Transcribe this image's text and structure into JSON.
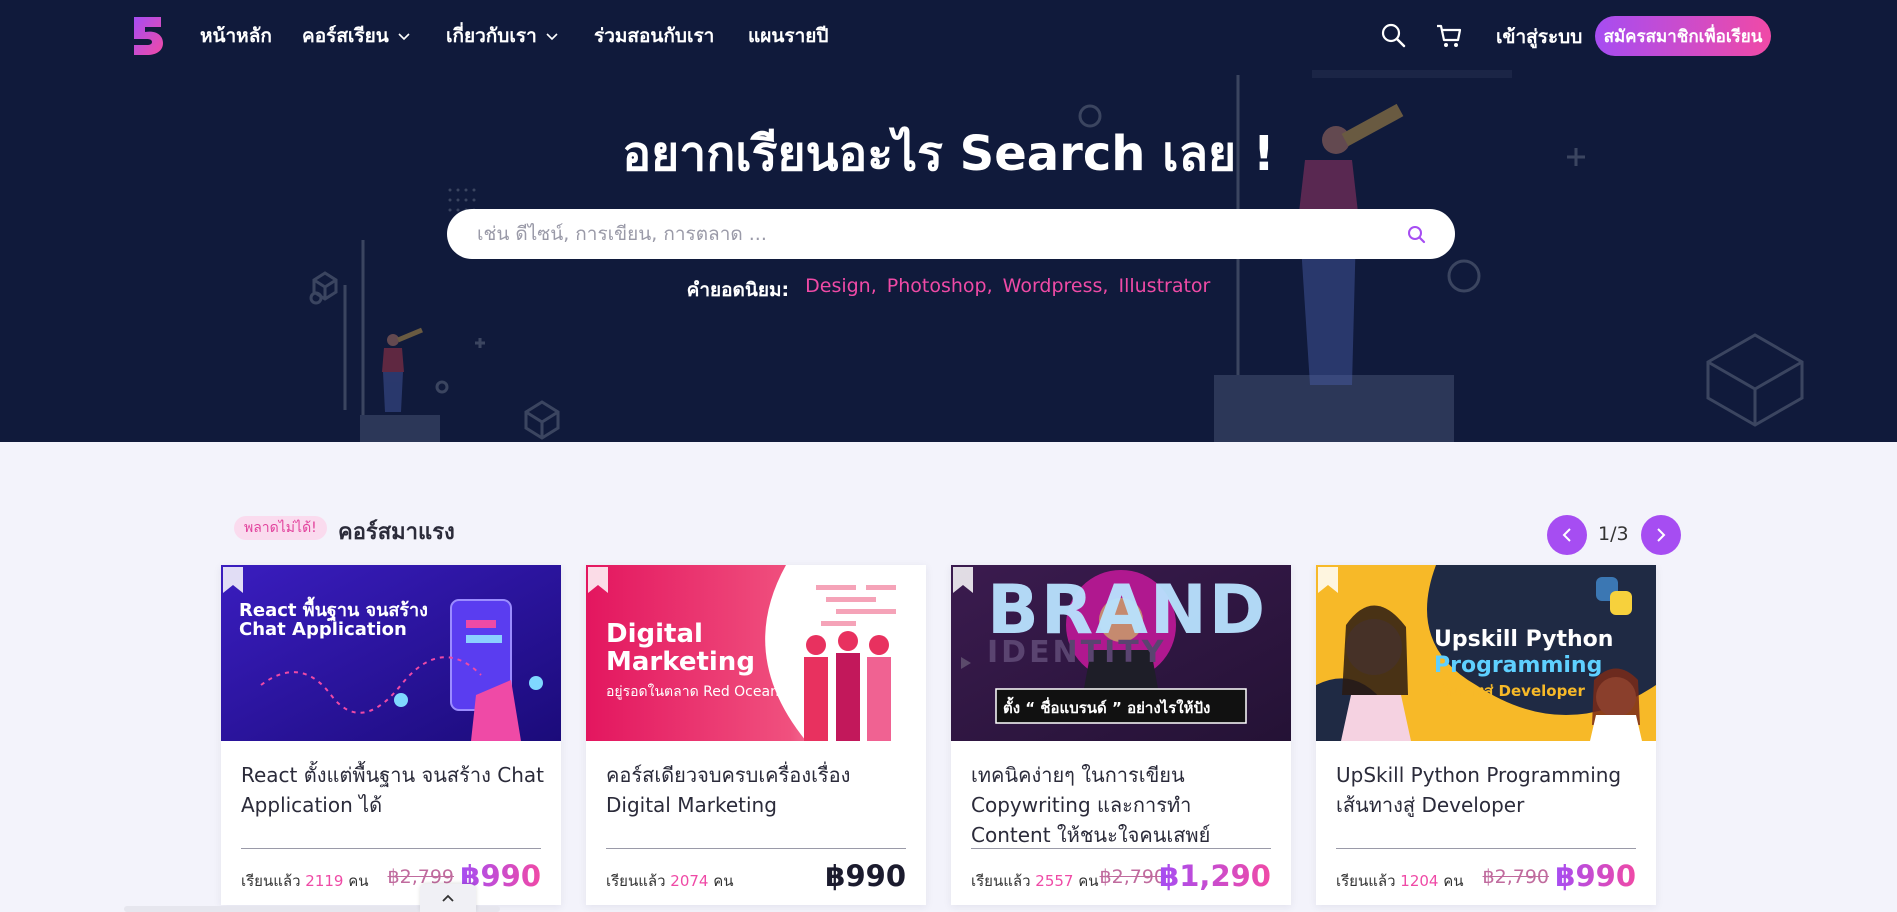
{
  "nav": {
    "logo": "logo",
    "items": [
      {
        "label": "หน้าหลัก",
        "has_dropdown": false
      },
      {
        "label": "คอร์สเรียน",
        "has_dropdown": true
      },
      {
        "label": "เกี่ยวกับเรา",
        "has_dropdown": true
      },
      {
        "label": "ร่วมสอนกับเรา",
        "has_dropdown": false
      },
      {
        "label": "แผนรายปี",
        "has_dropdown": false
      }
    ],
    "search_icon": "search-icon",
    "cart_icon": "cart-icon",
    "login_label": "เข้าสู่ระบบ",
    "signup_label": "สมัครสมาชิกเพื่อเรียน"
  },
  "hero": {
    "title": "อยากเรียนอะไร Search เลย !",
    "search_placeholder": "เช่น ดีไซน์, การเขียน, การตลาด ...",
    "popular_label": "คำยอดนิยม:",
    "popular_tags": [
      "Design,",
      "Photoshop,",
      "Wordpress,",
      "Illustrator"
    ]
  },
  "section": {
    "badge": "พลาดไม่ได้!",
    "title": "คอร์สมาแรง",
    "pager": "1/3"
  },
  "courses": [
    {
      "thumb_line1": "React พื้นฐาน จนสร้าง",
      "thumb_line2": "Chat Application",
      "title": "React ตั้งแต่พื้นฐาน จนสร้าง Chat Application ได้",
      "students_label": "เรียนแล้ว",
      "students": "2119",
      "unit": "คน",
      "old_price": "฿2,799",
      "price": "฿990"
    },
    {
      "thumb_line1": "Digital",
      "thumb_line2": "Marketing",
      "thumb_line3": "อยู่รอดในตลาด Red Ocean",
      "title": "คอร์สเดียวจบครบเครื่องเรื่อง Digital Marketing",
      "students_label": "เรียนแล้ว",
      "students": "2074",
      "unit": "คน",
      "old_price": "",
      "price": "฿990"
    },
    {
      "thumb_line1": "BRAND",
      "thumb_line2": "IDENTITY",
      "thumb_line3": "ตั้ง “ ชื่อแบรนด์ ” อย่างไรให้ปัง",
      "title": "เทคนิคง่ายๆ ในการเขียน Copywriting และการทำ Content ให้ชนะใจคนเสพย์",
      "students_label": "เรียนแล้ว",
      "students": "2557",
      "unit": "คน",
      "old_price": "฿2,790",
      "price": "฿1,290"
    },
    {
      "thumb_line1": "Upskill Python",
      "thumb_line2": "Programming",
      "thumb_line3": "เส้นทางสู่ Developer",
      "title": "UpSkill Python Programming เส้นทางสู่ Developer",
      "students_label": "เรียนแล้ว",
      "students": "1204",
      "unit": "คน",
      "old_price": "฿2,790",
      "price": "฿990"
    }
  ],
  "colors": {
    "navy": "#101a3b",
    "accent_purple": "#a64df2",
    "accent_pink": "#ef4aa6",
    "page_bg": "#f3f3fb"
  }
}
